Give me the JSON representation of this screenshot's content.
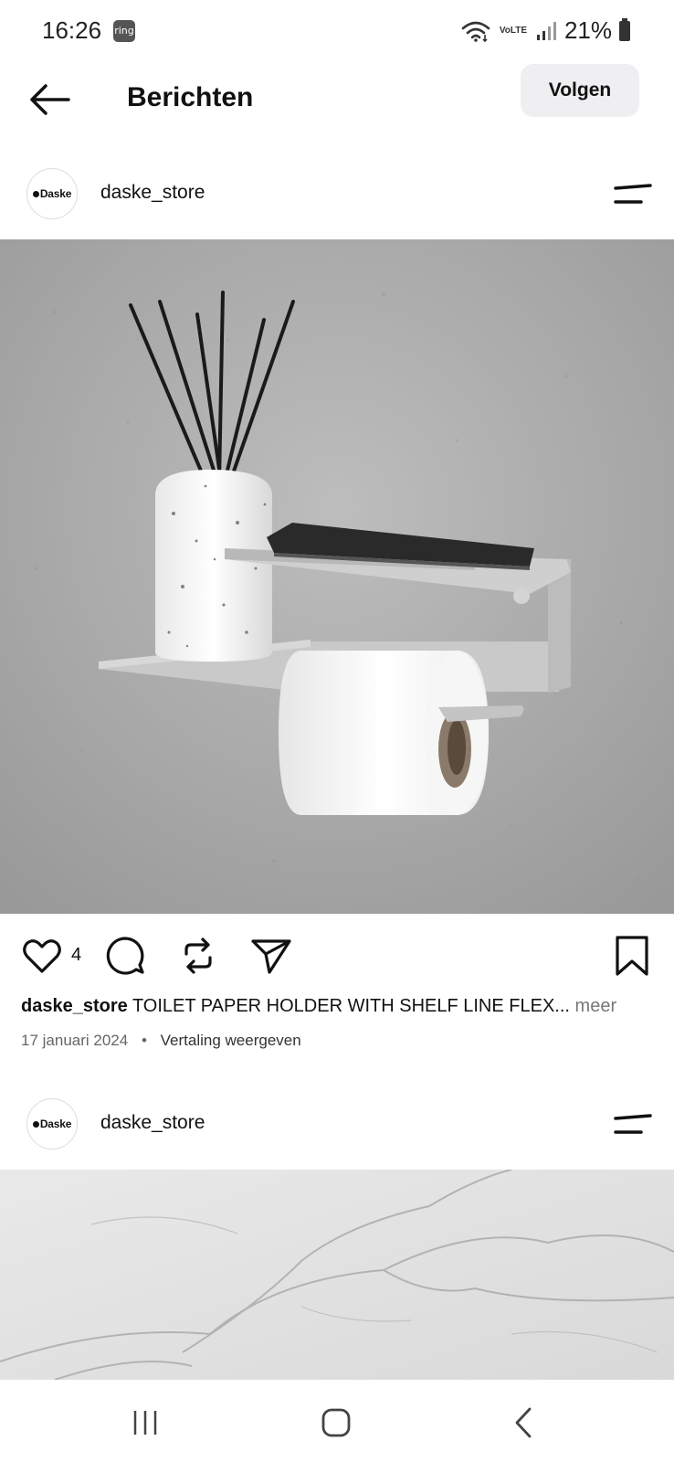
{
  "status_bar": {
    "time": "16:26",
    "notification_badge": "ring",
    "network_label": "VoLTE",
    "battery": "21%"
  },
  "header": {
    "title": "Berichten",
    "follow_label": "Volgen"
  },
  "posts": [
    {
      "avatar_text": "Daske",
      "username": "daske_store",
      "likes": "4",
      "caption_user": "daske_store",
      "caption_text": "TOILET PAPER HOLDER WITH SHELF LINE FLEX",
      "caption_ellipsis": "...",
      "caption_more": "meer",
      "date": "17 januari 2024",
      "meta_separator": "•",
      "translate_label": "Vertaling weergeven"
    },
    {
      "avatar_text": "Daske",
      "username": "daske_store"
    }
  ],
  "icons": {
    "back": "arrow-left-icon",
    "menu": "menu-lines-icon",
    "like": "heart-icon",
    "comment": "comment-icon",
    "repost": "repost-icon",
    "share": "send-icon",
    "save": "bookmark-icon",
    "nav_recent": "recent-apps-icon",
    "nav_home": "home-icon",
    "nav_back": "chevron-left-icon"
  },
  "colors": {
    "follow_button_bg": "#efeff2",
    "text_primary": "#111111",
    "text_secondary": "#666666"
  }
}
